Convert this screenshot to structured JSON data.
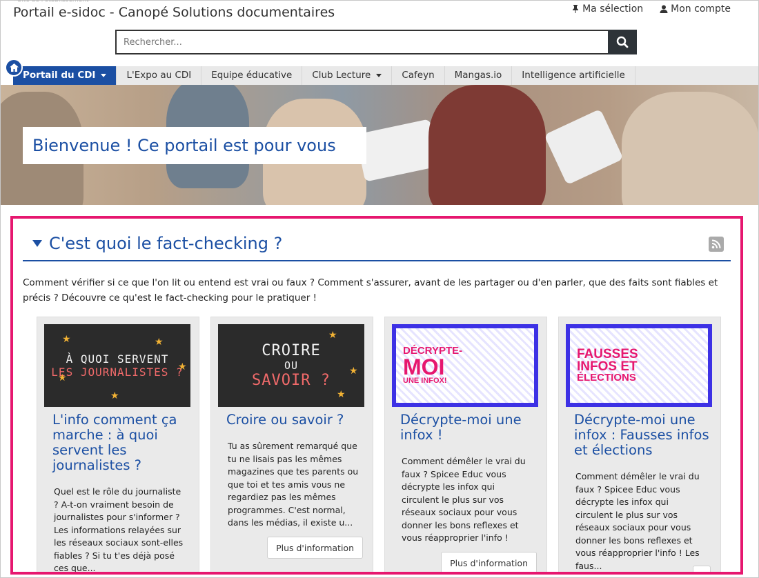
{
  "header": {
    "title": "Portail e-sidoc - Canopé Solutions documentaires",
    "my_selection": "Ma sélection",
    "my_account": "Mon compte"
  },
  "search": {
    "placeholder": "Rechercher..."
  },
  "nav": {
    "items": [
      {
        "label": "Portail du CDI",
        "active": true,
        "dropdown": true
      },
      {
        "label": "L'Expo au CDI"
      },
      {
        "label": "Equipe éducative"
      },
      {
        "label": "Club Lecture",
        "dropdown": true
      },
      {
        "label": "Cafeyn"
      },
      {
        "label": "Mangas.io"
      },
      {
        "label": "Intelligence artificielle"
      }
    ]
  },
  "banner": {
    "welcome": "Bienvenue ! Ce portail est pour vous"
  },
  "section": {
    "title": "C'est quoi le fact-checking ?",
    "description": "Comment vérifier si ce que l'on lit ou entend est vrai ou faux ? Comment s'assurer, avant de les partager ou d'en parler, que des faits sont fiables et précis ? Découvre ce qu'est le fact-checking pour le pratiquer !"
  },
  "cards": [
    {
      "thumb_line1": "À QUOI SERVENT",
      "thumb_line2": "LES JOURNALISTES ?",
      "title": "L'info comment ça marche : à quoi servent les journalistes ?",
      "text": "Quel est le rôle du journaliste ? A-t-on vraiment besoin de journalistes pour s'informer ? Les informations relayées sur les réseaux sociaux sont-elles fiables ? Si tu t'es déjà posé ces que..."
    },
    {
      "thumb_line1": "CROIRE",
      "thumb_line2": "OU",
      "thumb_line3": "SAVOIR ?",
      "title": "Croire ou savoir ?",
      "text": "Tu as sûrement remarqué que tu ne lisais pas les mêmes magazines que tes parents ou que toi et tes amis vous ne regardiez pas les mêmes programmes. C'est normal, dans les médias, il existe u...",
      "button": "Plus d'information"
    },
    {
      "thumb_line1": "DÉCRYPTE-",
      "thumb_line2": "MOI",
      "thumb_line3": "UNE INFOX!",
      "title": "Décrypte-moi une infox !",
      "text": "Comment démêler le vrai du faux ? Spicee Educ vous décrypte les infox qui circulent le plus sur vos réseaux sociaux pour vous donner les bons reflexes et vous réapproprier l'info !",
      "button": "Plus d'information"
    },
    {
      "thumb_line1": "FAUSSES",
      "thumb_line2": "INFOS ET",
      "thumb_line3": "ÉLECTIONS",
      "title": "Décrypte-moi une infox : Fausses infos et élections",
      "text": "Comment démêler le vrai du faux ? Spicee Educ vous décrypte les infox qui circulent le plus sur vos réseaux sociaux pour vous donner les bons reflexes et vous réapproprier l'info ! Les faus..."
    }
  ],
  "colors": {
    "brand_blue": "#1b4fa3",
    "highlight_pink": "#e6176f",
    "dark_button": "#2d3338"
  }
}
